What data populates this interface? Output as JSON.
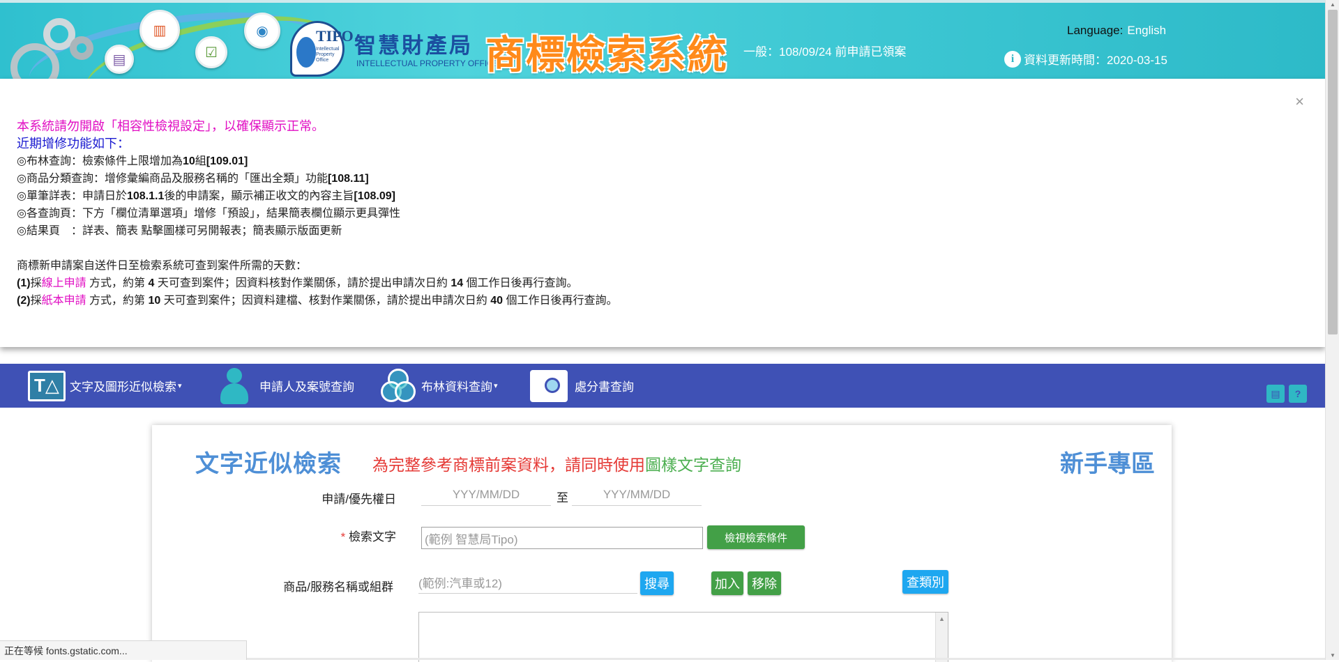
{
  "header": {
    "org_name_zh": "智慧財產局",
    "org_name_en": "INTELLECTUAL PROPERTY OFFICE",
    "logo_text": "TIPO",
    "logo_sub": "Intellectual Property Office",
    "system_title": "商標檢索系統",
    "notice": "一般：108/09/24 前申請已領案",
    "language_label": "Language:",
    "language_link": "English",
    "update_label": "資料更新時間：2020-03-15",
    "info_icon_glyph": "i"
  },
  "announcement": {
    "close_glyph": "×",
    "line1": "本系統請勿開啟「相容性檢視設定」，以確保顯示正常。",
    "line2": "近期增修功能如下：",
    "items": [
      {
        "pre": "◎布林查詢：檢索條件上限增加為",
        "bold": "10",
        "post": "組",
        "tag": "[109.01]"
      },
      {
        "pre": "◎商品分類查詢：增修彙編商品及服務名稱的「匯出全類」功能",
        "bold": "",
        "post": "",
        "tag": "[108.11]"
      },
      {
        "pre": "◎單筆詳表：申請日於",
        "bold": "108.1.1",
        "post": "後的申請案，顯示補正收文的內容主旨",
        "tag": "[108.09]"
      },
      {
        "pre": "◎各查詢頁：下方「欄位清單選項」增修「預設」，結果簡表欄位顯示更具彈性",
        "bold": "",
        "post": "",
        "tag": ""
      },
      {
        "pre": "◎結果頁　：詳表、簡表 點擊圖樣可另開報表；簡表顯示版面更新",
        "bold": "",
        "post": "",
        "tag": ""
      }
    ],
    "days_title": "商標新申請案自送件日至檢索系統可查到案件所需的天數：",
    "days": [
      {
        "num": "(1)",
        "a": "採",
        "hl": "線上申請",
        "b": " 方式，約第 ",
        "d1": "4",
        "c": " 天可查到案件；因資料核對作業關係，請於提出申請次日約 ",
        "d2": "14",
        "e": " 個工作日後再行查詢。"
      },
      {
        "num": "(2)",
        "a": "採",
        "hl": "紙本申請",
        "b": " 方式，約第 ",
        "d1": "10",
        "c": " 天可查到案件；因資料建檔、核對作業關係，請於提出申請次日約 ",
        "d2": "40",
        "e": " 個工作日後再行查詢。"
      }
    ]
  },
  "nav": {
    "items": [
      {
        "label": "文字及圖形近似檢索",
        "icon_text": "T△",
        "caret": "▾"
      },
      {
        "label": "申請人及案號查詢"
      },
      {
        "label": "布林資料查詢",
        "caret": "▾"
      },
      {
        "label": "處分書查詢"
      }
    ],
    "right_icons": [
      "▤",
      "?"
    ]
  },
  "search": {
    "title": "文字近似檢索",
    "subtitle_red": "為完整參考商標前案資料，請同時使用",
    "subtitle_green": "圖樣文字查詢",
    "help_zone": "新手專區",
    "date_label": "申請/優先權日",
    "date_from_placeholder": "YYY/MM/DD",
    "date_to_sep": "至",
    "date_to_placeholder": "YYY/MM/DD",
    "keyword_required": "*",
    "keyword_label": "檢索文字",
    "keyword_placeholder": "(範例  智慧局Tipo)",
    "view_conditions_button": "檢視檢索條件",
    "goods_label": "商品/服務名稱或組群",
    "goods_placeholder": "(範例:汽車或12)",
    "search_button": "搜尋",
    "add_button": "加入",
    "remove_button": "移除",
    "class_button": "查類別"
  },
  "status_bar": "正在等候 fonts.gstatic.com..."
}
